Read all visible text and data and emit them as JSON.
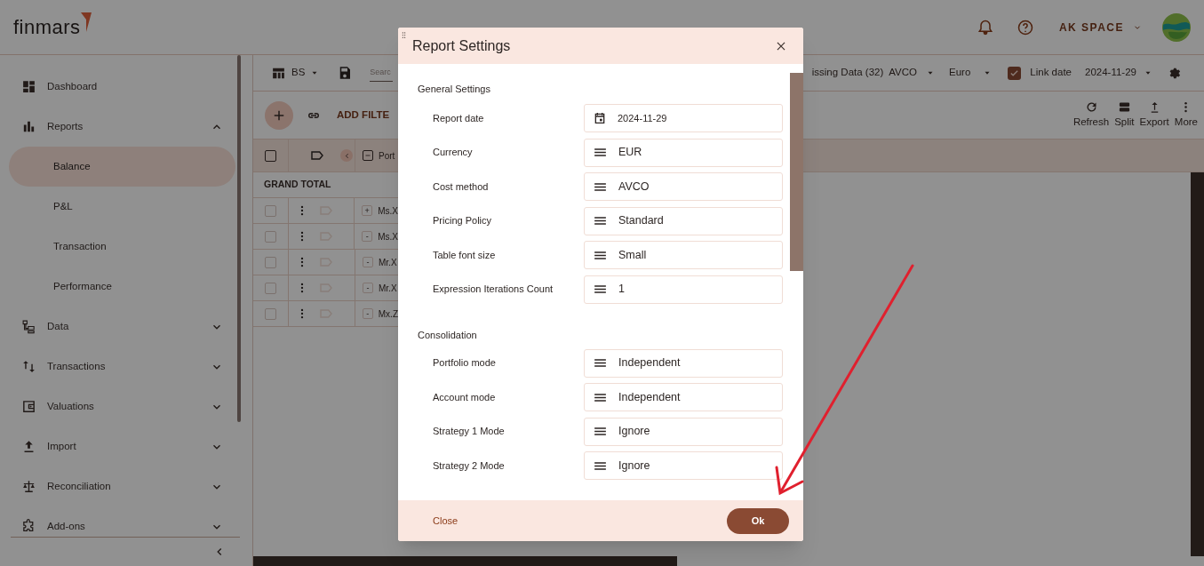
{
  "header": {
    "logo": "finmars",
    "workspace": "AK SPACE"
  },
  "sidebar": {
    "items": [
      {
        "label": "Dashboard"
      },
      {
        "label": "Reports",
        "expanded": true,
        "children": [
          {
            "label": "Balance",
            "selected": true
          },
          {
            "label": "P&L",
            "selected": false
          },
          {
            "label": "Transaction",
            "selected": false
          },
          {
            "label": "Performance",
            "selected": false
          }
        ]
      },
      {
        "label": "Data",
        "expanded": false
      },
      {
        "label": "Transactions",
        "expanded": false
      },
      {
        "label": "Valuations",
        "expanded": false
      },
      {
        "label": "Import",
        "expanded": false
      },
      {
        "label": "Reconciliation",
        "expanded": false
      },
      {
        "label": "Add-ons",
        "expanded": false
      }
    ]
  },
  "toolbar": {
    "layout": "BS",
    "search": {
      "placeholder": "Searc"
    },
    "missing_data": "issing Data (32)",
    "cost_method": "AVCO",
    "currency": "Euro",
    "link_date": {
      "label": "Link date",
      "checked": true
    },
    "date": "2024-11-29",
    "add_filter": "ADD FILTE",
    "actions": [
      "Refresh",
      "Split",
      "Export",
      "More"
    ]
  },
  "table": {
    "select_all": {
      "checked": false
    },
    "column_3": "Port",
    "grand_total": "GRAND TOTAL",
    "rows": [
      {
        "checked": false,
        "toggle": "+",
        "name": "Ms.X"
      },
      {
        "checked": false,
        "toggle": "-",
        "name": "Ms.X"
      },
      {
        "checked": false,
        "toggle": "-",
        "name": "Mr.X"
      },
      {
        "checked": false,
        "toggle": "-",
        "name": "Mr.X"
      },
      {
        "checked": false,
        "toggle": "-",
        "name": "Mx.Z"
      }
    ]
  },
  "dialog": {
    "title": "Report Settings",
    "sections": [
      {
        "title": "General Settings",
        "rows": [
          {
            "label": "Report date",
            "kind": "date",
            "value": "2024-11-29"
          },
          {
            "label": "Currency",
            "kind": "select",
            "value": "EUR"
          },
          {
            "label": "Cost method",
            "kind": "select",
            "value": "AVCO"
          },
          {
            "label": "Pricing Policy",
            "kind": "select",
            "value": "Standard"
          },
          {
            "label": "Table font size",
            "kind": "select",
            "value": "Small"
          },
          {
            "label": "Expression Iterations Count",
            "kind": "select",
            "value": "1"
          }
        ]
      },
      {
        "title": "Consolidation",
        "rows": [
          {
            "label": "Portfolio mode",
            "kind": "select",
            "value": "Independent"
          },
          {
            "label": "Account mode",
            "kind": "select",
            "value": "Independent"
          },
          {
            "label": "Strategy 1 Mode",
            "kind": "select",
            "value": "Ignore"
          },
          {
            "label": "Strategy 2 Mode",
            "kind": "select",
            "value": "Ignore"
          }
        ]
      }
    ],
    "buttons": [
      {
        "label": "Close",
        "kind": "text"
      },
      {
        "label": "Ok",
        "kind": "primary"
      }
    ]
  }
}
